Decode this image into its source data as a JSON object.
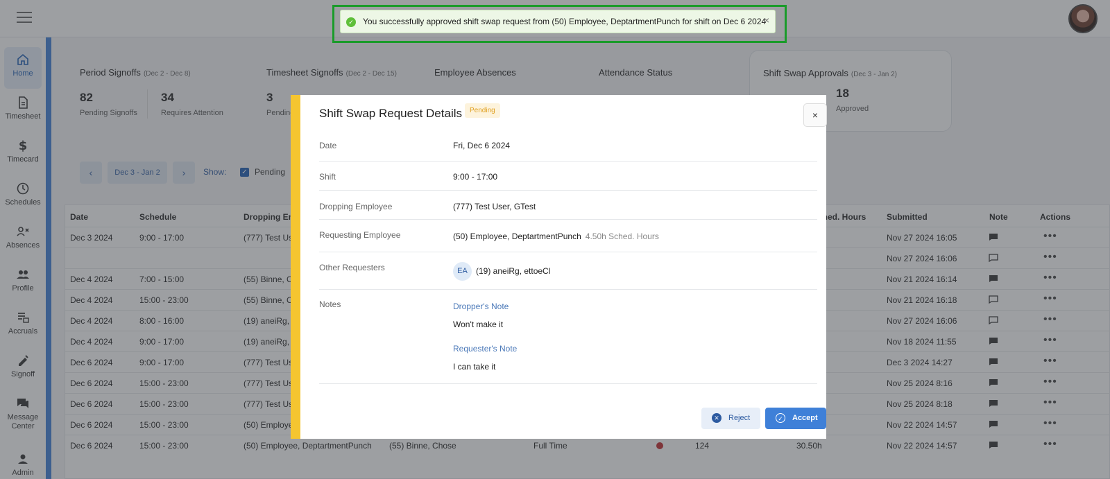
{
  "toast": {
    "message": "You successfully approved shift swap request from (50) Employee, DeptartmentPunch for shift on Dec 6 2024",
    "close": "×"
  },
  "sidebar": {
    "items": [
      {
        "label": "Home",
        "icon": "home-icon"
      },
      {
        "label": "Timesheet",
        "icon": "document-icon"
      },
      {
        "label": "Timecard",
        "icon": "dollar-icon"
      },
      {
        "label": "Schedules",
        "icon": "clock-icon"
      },
      {
        "label": "Absences",
        "icon": "person-x-icon"
      },
      {
        "label": "Profile",
        "icon": "people-icon"
      },
      {
        "label": "Accruals",
        "icon": "accruals-icon"
      },
      {
        "label": "Signoff",
        "icon": "signoff-icon"
      },
      {
        "label": "Message Center",
        "icon": "chat-icon"
      },
      {
        "label": "Admin",
        "icon": "person-icon"
      }
    ]
  },
  "stats": {
    "period": {
      "title": "Period Signoffs",
      "range": "(Dec 2 - Dec 8)",
      "n1": "82",
      "s1": "Pending Signoffs",
      "n2": "34",
      "s2": "Requires Attention"
    },
    "timesheet": {
      "title": "Timesheet Signoffs",
      "range": "(Dec 2 - Dec 15)",
      "n1": "3",
      "s1": "Pending"
    },
    "absences": {
      "title": "Employee Absences"
    },
    "attendance": {
      "title": "Attendance Status"
    },
    "swap": {
      "title": "Shift Swap Approvals",
      "range": "(Dec 3 - Jan 2)",
      "n2": "18",
      "s2": "Approved"
    }
  },
  "filters": {
    "range": "Dec 3 - Jan 2",
    "show_label": "Show:",
    "pending_label": "Pending",
    "prev": "‹",
    "next": "›"
  },
  "table": {
    "headers": {
      "date": "Date",
      "schedule": "Schedule",
      "dropping": "Dropping Emp",
      "sched_hours": "Sched. Hours",
      "submitted": "Submitted",
      "note": "Note",
      "actions": "Actions"
    },
    "rows": [
      {
        "date": "Dec 3 2024",
        "schedule": "9:00 - 17:00",
        "dropping": "(777) Test Us",
        "submitted": "Nov 27 2024 16:05",
        "note": "filled"
      },
      {
        "date": "",
        "schedule": "",
        "dropping": "",
        "submitted": "Nov 27 2024 16:06",
        "note": "outline"
      },
      {
        "date": "Dec 4 2024",
        "schedule": "7:00 - 15:00",
        "dropping": "(55) Binne, Cl",
        "submitted": "Nov 21 2024 16:14",
        "note": "filled"
      },
      {
        "date": "Dec 4 2024",
        "schedule": "15:00 - 23:00",
        "dropping": "(55) Binne, Cl",
        "submitted": "Nov 21 2024 16:18",
        "note": "outline"
      },
      {
        "date": "Dec 4 2024",
        "schedule": "8:00 - 16:00",
        "dropping": "(19) aneiRg, e",
        "submitted": "Nov 27 2024 16:06",
        "note": "outline"
      },
      {
        "date": "Dec 4 2024",
        "schedule": "9:00 - 17:00",
        "dropping": "(19) aneiRg, e",
        "submitted": "Nov 18 2024 11:55",
        "note": "filled"
      },
      {
        "date": "Dec 6 2024",
        "schedule": "9:00 - 17:00",
        "dropping": "(777) Test Us",
        "submitted": "Dec 3 2024 14:27",
        "note": "filled"
      },
      {
        "date": "Dec 6 2024",
        "schedule": "15:00 - 23:00",
        "dropping": "(777) Test Us",
        "submitted": "Nov 25 2024 8:16",
        "note": "filled"
      },
      {
        "date": "Dec 6 2024",
        "schedule": "15:00 - 23:00",
        "dropping": "(777) Test Us",
        "submitted": "Nov 25 2024 8:18",
        "note": "filled"
      },
      {
        "date": "Dec 6 2024",
        "schedule": "15:00 - 23:00",
        "dropping": "(50) Employe",
        "submitted": "Nov 22 2024 14:57",
        "note": "filled"
      }
    ],
    "last_row": {
      "date": "Dec 6 2024",
      "schedule": "15:00 - 23:00",
      "dropping": "(50) Employee, DeptartmentPunch",
      "requesting": "(55) Binne, Chose",
      "type": "Full Time",
      "num": "124",
      "hours": "30.50h",
      "submitted": "Nov 22 2024 14:57"
    },
    "actions_glyph": "•••"
  },
  "modal": {
    "title": "Shift Swap Request Details",
    "status": "Pending",
    "close": "×",
    "date_label": "Date",
    "date_value": "Fri, Dec 6 2024",
    "shift_label": "Shift",
    "shift_value": "9:00 - 17:00",
    "dropping_label": "Dropping Employee",
    "dropping_value": "(777) Test User, GTest",
    "requesting_label": "Requesting Employee",
    "requesting_value": "(50) Employee, DeptartmentPunch",
    "requesting_hours": "4.50h Sched. Hours",
    "other_label": "Other Requesters",
    "other_initials": "EA",
    "other_value": "(19) aneiRg, ettoeCl",
    "notes_label": "Notes",
    "dropper_note_label": "Dropper's Note",
    "dropper_note": "Won't make it",
    "requester_note_label": "Requester's Note",
    "requester_note": "I can take it",
    "reject_label": "Reject",
    "accept_label": "Accept"
  },
  "colors": {
    "accent": "#3f80d8",
    "pending": "#f5c530",
    "toast_border": "#1a9b2a"
  }
}
